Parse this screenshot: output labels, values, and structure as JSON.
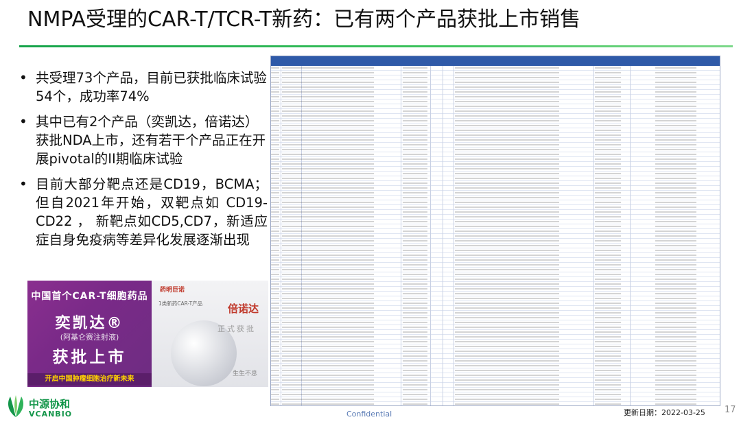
{
  "title": "NMPA受理的CAR-T/TCR-T新药：已有两个产品获批上市销售",
  "bullets": [
    "共受理73个产品，目前已获批临床试验54个，成功率74%",
    "其中已有2个产品（奕凯达，倍诺达）获批NDA上市，还有若干个产品正在开展pivotal的II期临床试验",
    "目前大部分靶点还是CD19，BCMA；但自2021年开始，双靶点如 CD19-CD22 ， 新靶点如CD5,CD7，新适应症自身免疫病等差异化发展逐渐出现"
  ],
  "ad_left": {
    "headline": "中国首个CAR-T细胞药品",
    "brand": "奕凯达®",
    "generic": "(阿基仑赛注射液)",
    "approved": "获批上市",
    "footer": "开启中国肿瘤细胞治疗新未来"
  },
  "ad_right": {
    "logo": "药明巨诺",
    "line1": "1类新药CAR-T产品",
    "brand": "倍诺达",
    "formal": "正式获批",
    "slogan": "生生不息"
  },
  "footer": {
    "company_cn": "中源协和",
    "company_en": "VCANBIO",
    "confidential": "Confidential",
    "update_date": "更新日期：2022-03-25",
    "page_number": "17"
  },
  "colors": {
    "accent_green": "#15a34a",
    "table_header_blue": "#2f5aa8",
    "ad_purple": "#7a2a88"
  }
}
